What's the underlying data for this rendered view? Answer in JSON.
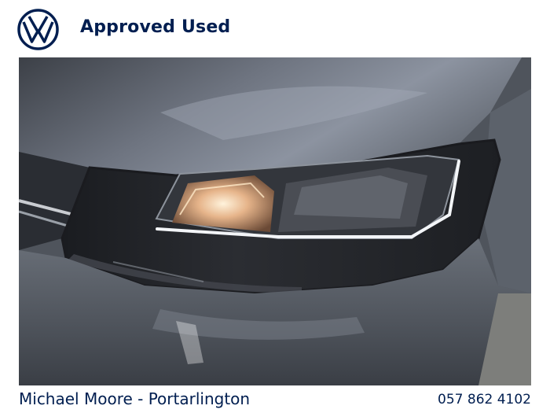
{
  "header": {
    "logo": "vw-logo",
    "title": "Approved Used"
  },
  "photo": {
    "subject": "car-headlight-photo"
  },
  "footer": {
    "dealer": "Michael Moore - Portarlington",
    "phone": "057 862 4102"
  },
  "colors": {
    "brand_navy": "#001e50",
    "car_body": "#5b6068"
  }
}
